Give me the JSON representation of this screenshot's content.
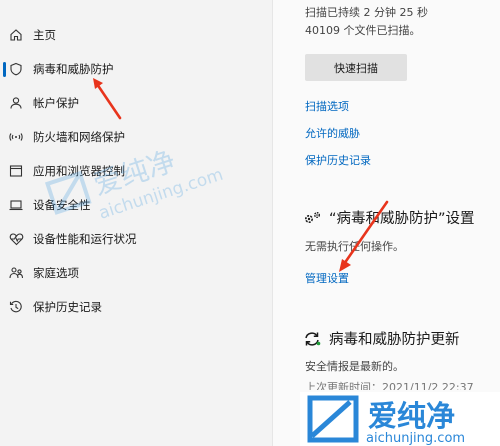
{
  "sidebar": {
    "items": [
      {
        "label": "主页",
        "icon": "home-icon"
      },
      {
        "label": "病毒和威胁防护",
        "icon": "shield-icon"
      },
      {
        "label": "帐户保护",
        "icon": "person-icon"
      },
      {
        "label": "防火墙和网络保护",
        "icon": "wifi-icon"
      },
      {
        "label": "应用和浏览器控制",
        "icon": "app-browser-icon"
      },
      {
        "label": "设备安全性",
        "icon": "laptop-icon"
      },
      {
        "label": "设备性能和运行状况",
        "icon": "heart-pulse-icon"
      },
      {
        "label": "家庭选项",
        "icon": "family-icon"
      },
      {
        "label": "保护历史记录",
        "icon": "history-icon"
      }
    ]
  },
  "main": {
    "scan_line1": "扫描已持续 2 分钟 25 秒",
    "scan_line2": "40109 个文件已扫描。",
    "quick_scan_label": "快速扫描",
    "links": [
      "扫描选项",
      "允许的威胁",
      "保护历史记录"
    ],
    "settings_title": "“病毒和威胁防护”设置",
    "settings_desc": "无需执行任何操作。",
    "manage_settings": "管理设置",
    "updates_title": "病毒和威胁防护更新",
    "updates_desc": "安全情报是最新的。",
    "updates_partial": "上次更新时间：2021/11/2 22:37"
  },
  "watermark": {
    "brand": "爱纯净",
    "site": "aichunjing.com"
  },
  "colors": {
    "accent": "#0067c0",
    "arrow": "#e8341c"
  }
}
